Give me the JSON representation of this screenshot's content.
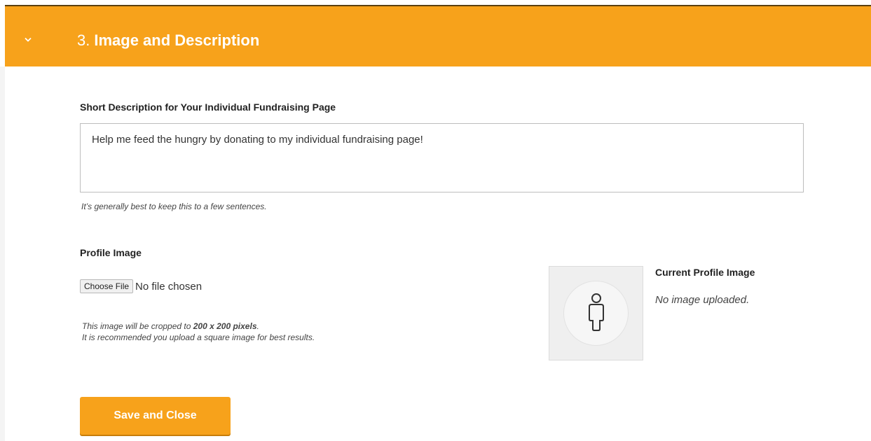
{
  "section": {
    "number": "3.",
    "title": "Image and Description",
    "accent_color": "#f7a21b",
    "toggle_icon": "chevron-down-icon"
  },
  "description": {
    "label": "Short Description for Your Individual Fundraising Page",
    "value": "Help me feed the hungry by donating to my individual fundraising page!",
    "hint": "It’s generally best to keep this to a few sentences."
  },
  "profile_image": {
    "label": "Profile Image",
    "choose_file_label": "Choose File",
    "no_file_text": "No file chosen",
    "crop_hint_prefix": "This image will be cropped to ",
    "crop_hint_size": "200 x 200 pixels",
    "crop_hint_suffix": ".",
    "recommend_hint": "It is recommended you upload a square image for best results.",
    "current_label": "Current Profile Image",
    "current_status": "No image uploaded.",
    "placeholder_icon": "person-icon"
  },
  "actions": {
    "save_label": "Save and Close"
  }
}
